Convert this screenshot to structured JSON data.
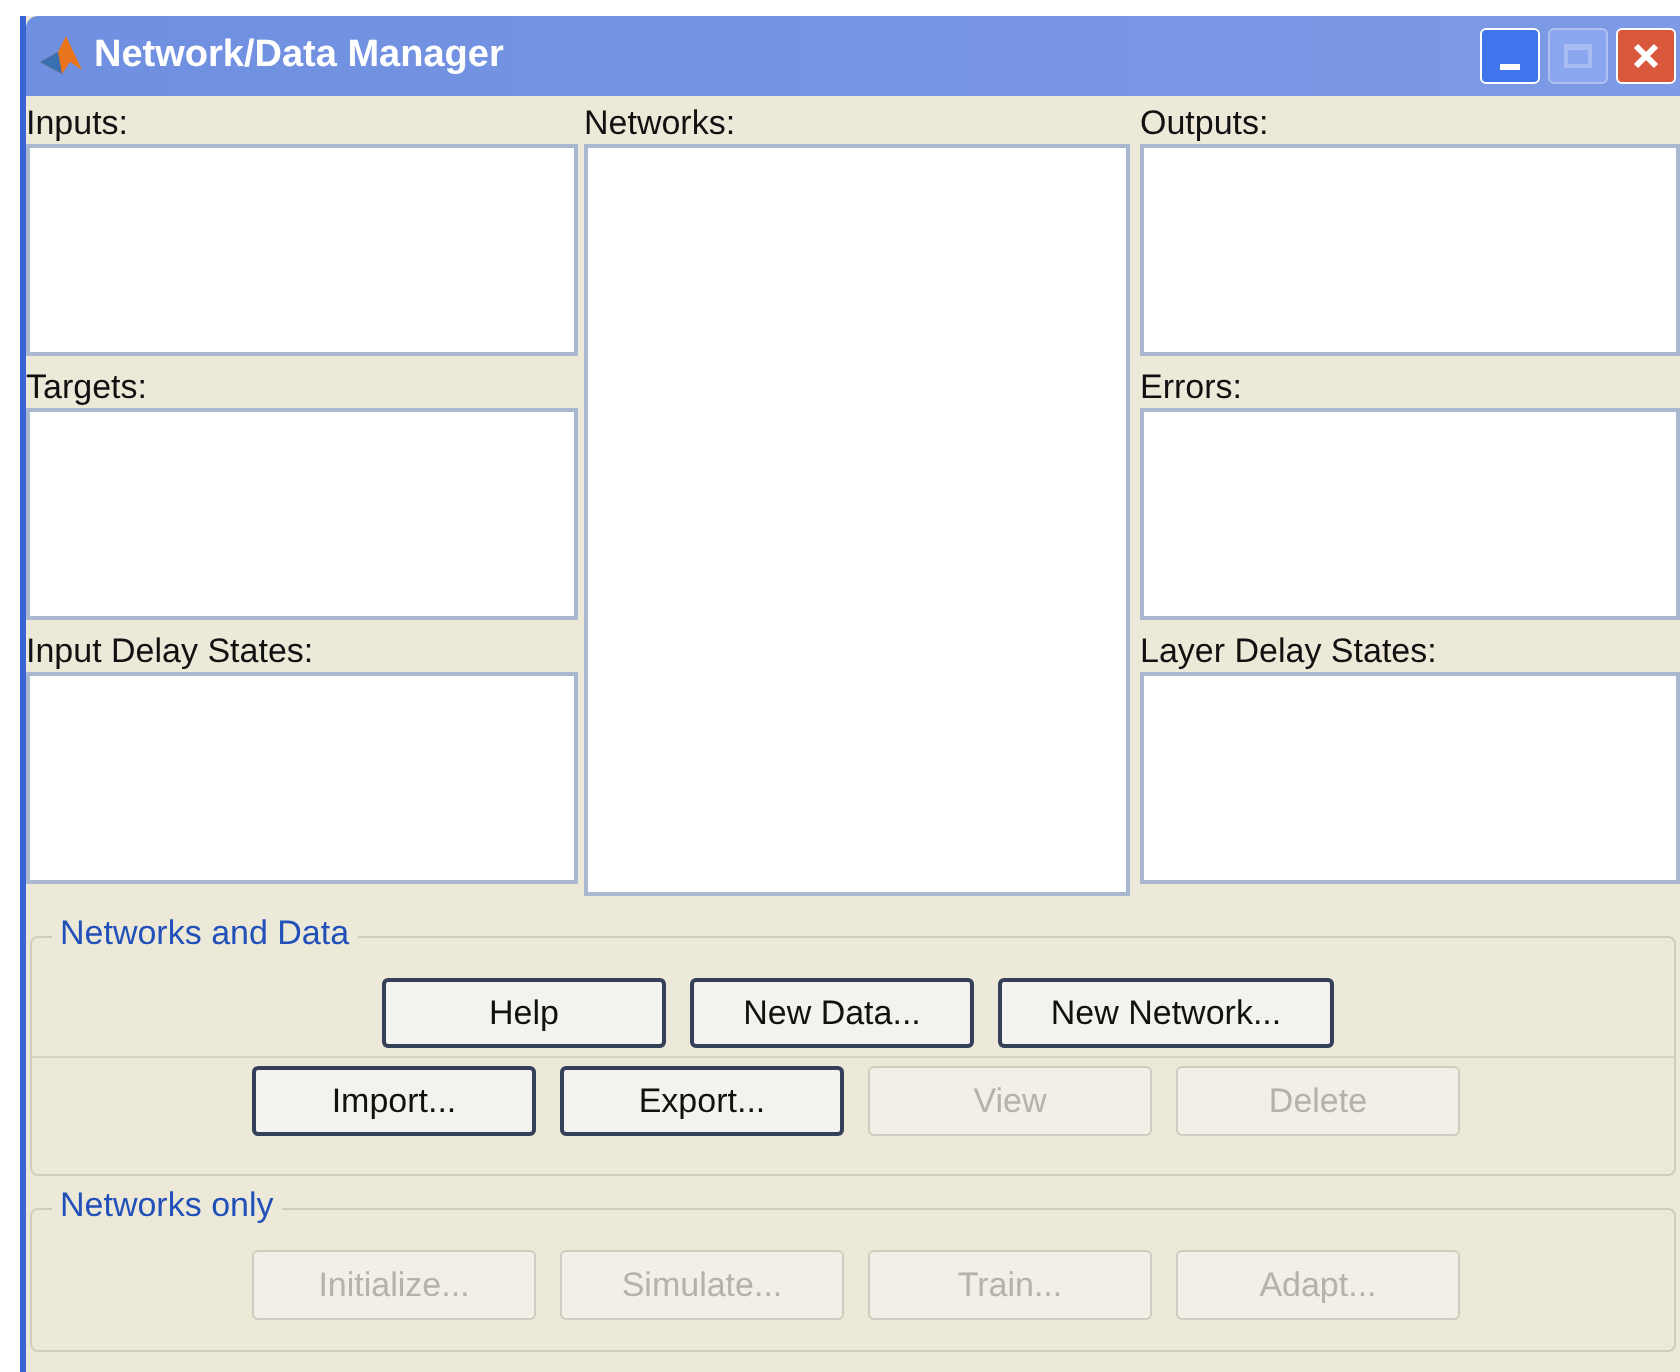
{
  "window": {
    "title": "Network/Data Manager"
  },
  "left_lists": [
    {
      "label": "Inputs:"
    },
    {
      "label": "Targets:"
    },
    {
      "label": "Input Delay States:"
    }
  ],
  "center_list": {
    "label": "Networks:"
  },
  "right_lists": [
    {
      "label": "Outputs:"
    },
    {
      "label": "Errors:"
    },
    {
      "label": "Layer Delay States:"
    }
  ],
  "groups": [
    {
      "title": "Networks and Data",
      "rows": [
        [
          {
            "label": "Help",
            "disabled": false
          },
          {
            "label": "New Data...",
            "disabled": false
          },
          {
            "label": "New Network...",
            "disabled": false
          }
        ],
        [
          {
            "label": "Import...",
            "disabled": false
          },
          {
            "label": "Export...",
            "disabled": false
          },
          {
            "label": "View",
            "disabled": true
          },
          {
            "label": "Delete",
            "disabled": true
          }
        ]
      ]
    },
    {
      "title": "Networks only",
      "rows": [
        [
          {
            "label": "Initialize...",
            "disabled": true
          },
          {
            "label": "Simulate...",
            "disabled": true
          },
          {
            "label": "Train...",
            "disabled": true
          },
          {
            "label": "Adapt...",
            "disabled": true
          }
        ]
      ]
    }
  ]
}
